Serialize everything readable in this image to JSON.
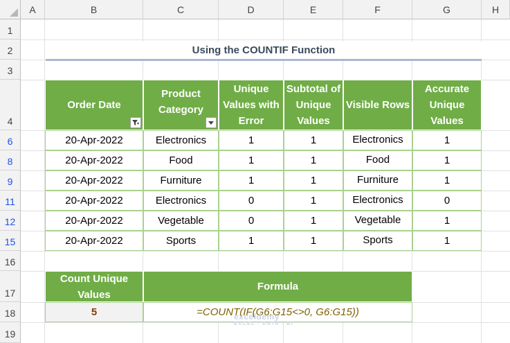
{
  "columns": [
    "A",
    "B",
    "C",
    "D",
    "E",
    "F",
    "G",
    "H"
  ],
  "rows": [
    "1",
    "2",
    "3",
    "4",
    "6",
    "8",
    "9",
    "11",
    "12",
    "15",
    "16",
    "17",
    "18",
    "19"
  ],
  "title": "Using the COUNTIF Function",
  "table": {
    "headers": [
      "Order Date",
      "Product Category",
      "Unique Values with Error",
      "Subtotal of Unique Values",
      "Visible Rows",
      "Accurate Unique Values"
    ],
    "rows": [
      [
        "20-Apr-2022",
        "Electronics",
        "1",
        "1",
        "Electronics",
        "1"
      ],
      [
        "20-Apr-2022",
        "Food",
        "1",
        "1",
        "Food",
        "1"
      ],
      [
        "20-Apr-2022",
        "Furniture",
        "1",
        "1",
        "Furniture",
        "1"
      ],
      [
        "20-Apr-2022",
        "Electronics",
        "0",
        "1",
        "Electronics",
        "0"
      ],
      [
        "20-Apr-2022",
        "Vegetable",
        "0",
        "1",
        "Vegetable",
        "1"
      ],
      [
        "20-Apr-2022",
        "Sports",
        "1",
        "1",
        "Sports",
        "1"
      ]
    ]
  },
  "summary": {
    "count_header": "Count Unique Values",
    "formula_header": "Formula",
    "count_value": "5",
    "formula": "=COUNT(IF(G6:G15<>0, G6:G15))"
  },
  "watermark": {
    "brand": "exceldemy",
    "tagline": "EXCEL · DATA · BI"
  },
  "colors": {
    "header_green": "#70ad47",
    "border_green": "#a9d18e",
    "filtered_row": "#1f4eea",
    "count_value": "#843c0c",
    "formula_text": "#7f6000"
  }
}
